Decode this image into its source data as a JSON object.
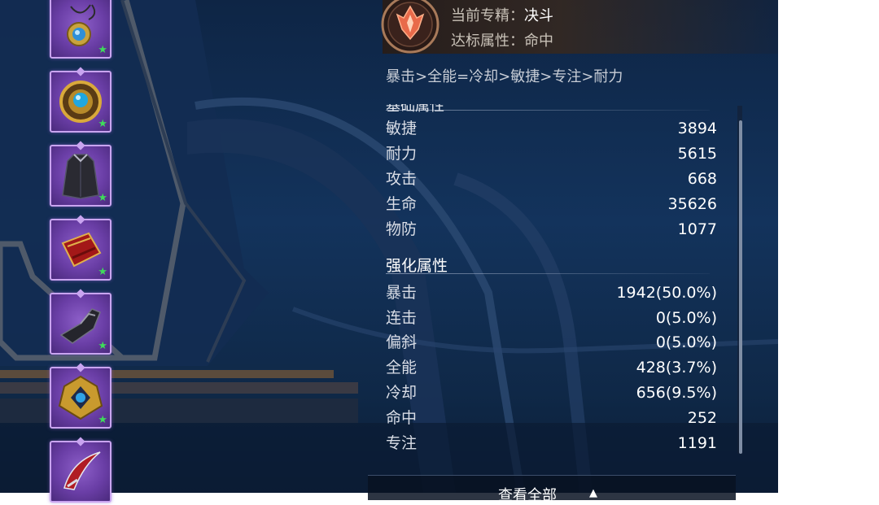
{
  "spec": {
    "label": "当前专精：",
    "value": "决斗",
    "attr_label": "达标属性：",
    "attr_value": "命中",
    "emblem_icon": "duel-spec-emblem-icon"
  },
  "priority_text": "暴击>全能=冷却>敏捷>专注>耐力",
  "base_section": {
    "title": "基础属性",
    "stats": [
      {
        "name": "敏捷",
        "value": "3894"
      },
      {
        "name": "耐力",
        "value": "5615"
      },
      {
        "name": "攻击",
        "value": "668"
      },
      {
        "name": "生命",
        "value": "35626"
      },
      {
        "name": "物防",
        "value": "1077"
      }
    ]
  },
  "enhanced_section": {
    "title": "强化属性",
    "stats": [
      {
        "name": "暴击",
        "value": "1942(50.0%)"
      },
      {
        "name": "连击",
        "value": "0(5.0%)"
      },
      {
        "name": "偏斜",
        "value": "0(5.0%)"
      },
      {
        "name": "全能",
        "value": "428(3.7%)"
      },
      {
        "name": "冷却",
        "value": "656(9.5%)"
      },
      {
        "name": "命中",
        "value": "252"
      },
      {
        "name": "专注",
        "value": "1191"
      }
    ]
  },
  "view_all": {
    "label": "查看全部",
    "arrow_icon": "up-arrow-icon"
  },
  "equipment": [
    {
      "icon": "amulet-necklace-icon"
    },
    {
      "icon": "blue-gem-ring-icon"
    },
    {
      "icon": "dark-cloak-icon"
    },
    {
      "icon": "red-bracer-icon"
    },
    {
      "icon": "dark-gauntlet-icon"
    },
    {
      "icon": "gold-gem-belt-icon"
    },
    {
      "icon": "crimson-blade-icon"
    }
  ],
  "colors": {
    "rarity_purple": "#7a4fbf",
    "star_green": "#3fdc5a",
    "panel_navy": "#13335c"
  }
}
